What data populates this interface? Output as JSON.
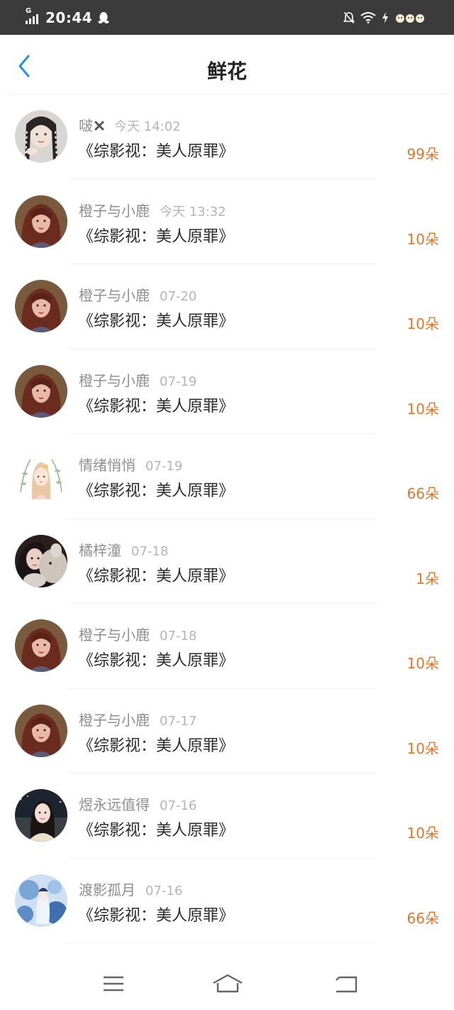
{
  "status_bar": {
    "network": "G",
    "time": "20:44"
  },
  "header": {
    "title": "鲜花",
    "back_icon": "chevron-left-icon"
  },
  "colors": {
    "accent_blue": "#2a8fe0",
    "count_orange": "#e5762a"
  },
  "items": [
    {
      "user": "啵",
      "time": "今天 14:02",
      "book": "《综影视：美人原罪》",
      "count": "99朵",
      "avatar": "girl-braids"
    },
    {
      "user": "橙子与小鹿",
      "time": "今天 13:32",
      "book": "《综影视：美人原罪》",
      "count": "10朵",
      "avatar": "red-hair-girl"
    },
    {
      "user": "橙子与小鹿",
      "time": "07-20",
      "book": "《综影视：美人原罪》",
      "count": "10朵",
      "avatar": "red-hair-girl"
    },
    {
      "user": "橙子与小鹿",
      "time": "07-19",
      "book": "《综影视：美人原罪》",
      "count": "10朵",
      "avatar": "red-hair-girl"
    },
    {
      "user": "情绪悄悄",
      "time": "07-19",
      "book": "《综影视：美人原罪》",
      "count": "66朵",
      "avatar": "illustrated-girl"
    },
    {
      "user": "橘梓潼",
      "time": "07-18",
      "book": "《综影视：美人原罪》",
      "count": "1朵",
      "avatar": "girl-with-plush"
    },
    {
      "user": "橙子与小鹿",
      "time": "07-18",
      "book": "《综影视：美人原罪》",
      "count": "10朵",
      "avatar": "red-hair-girl"
    },
    {
      "user": "橙子与小鹿",
      "time": "07-17",
      "book": "《综影视：美人原罪》",
      "count": "10朵",
      "avatar": "red-hair-girl"
    },
    {
      "user": "煜永远值得",
      "time": "07-16",
      "book": "《综影视：美人原罪》",
      "count": "10朵",
      "avatar": "girl-night-photo"
    },
    {
      "user": "渡影孤月",
      "time": "07-16",
      "book": "《综影视：美人原罪》",
      "count": "66朵",
      "avatar": "blue-illustration"
    }
  ],
  "bottom_bar": {
    "menu_icon": "menu-icon",
    "home_icon": "home-icon",
    "back_icon": "back-arrow-icon"
  }
}
